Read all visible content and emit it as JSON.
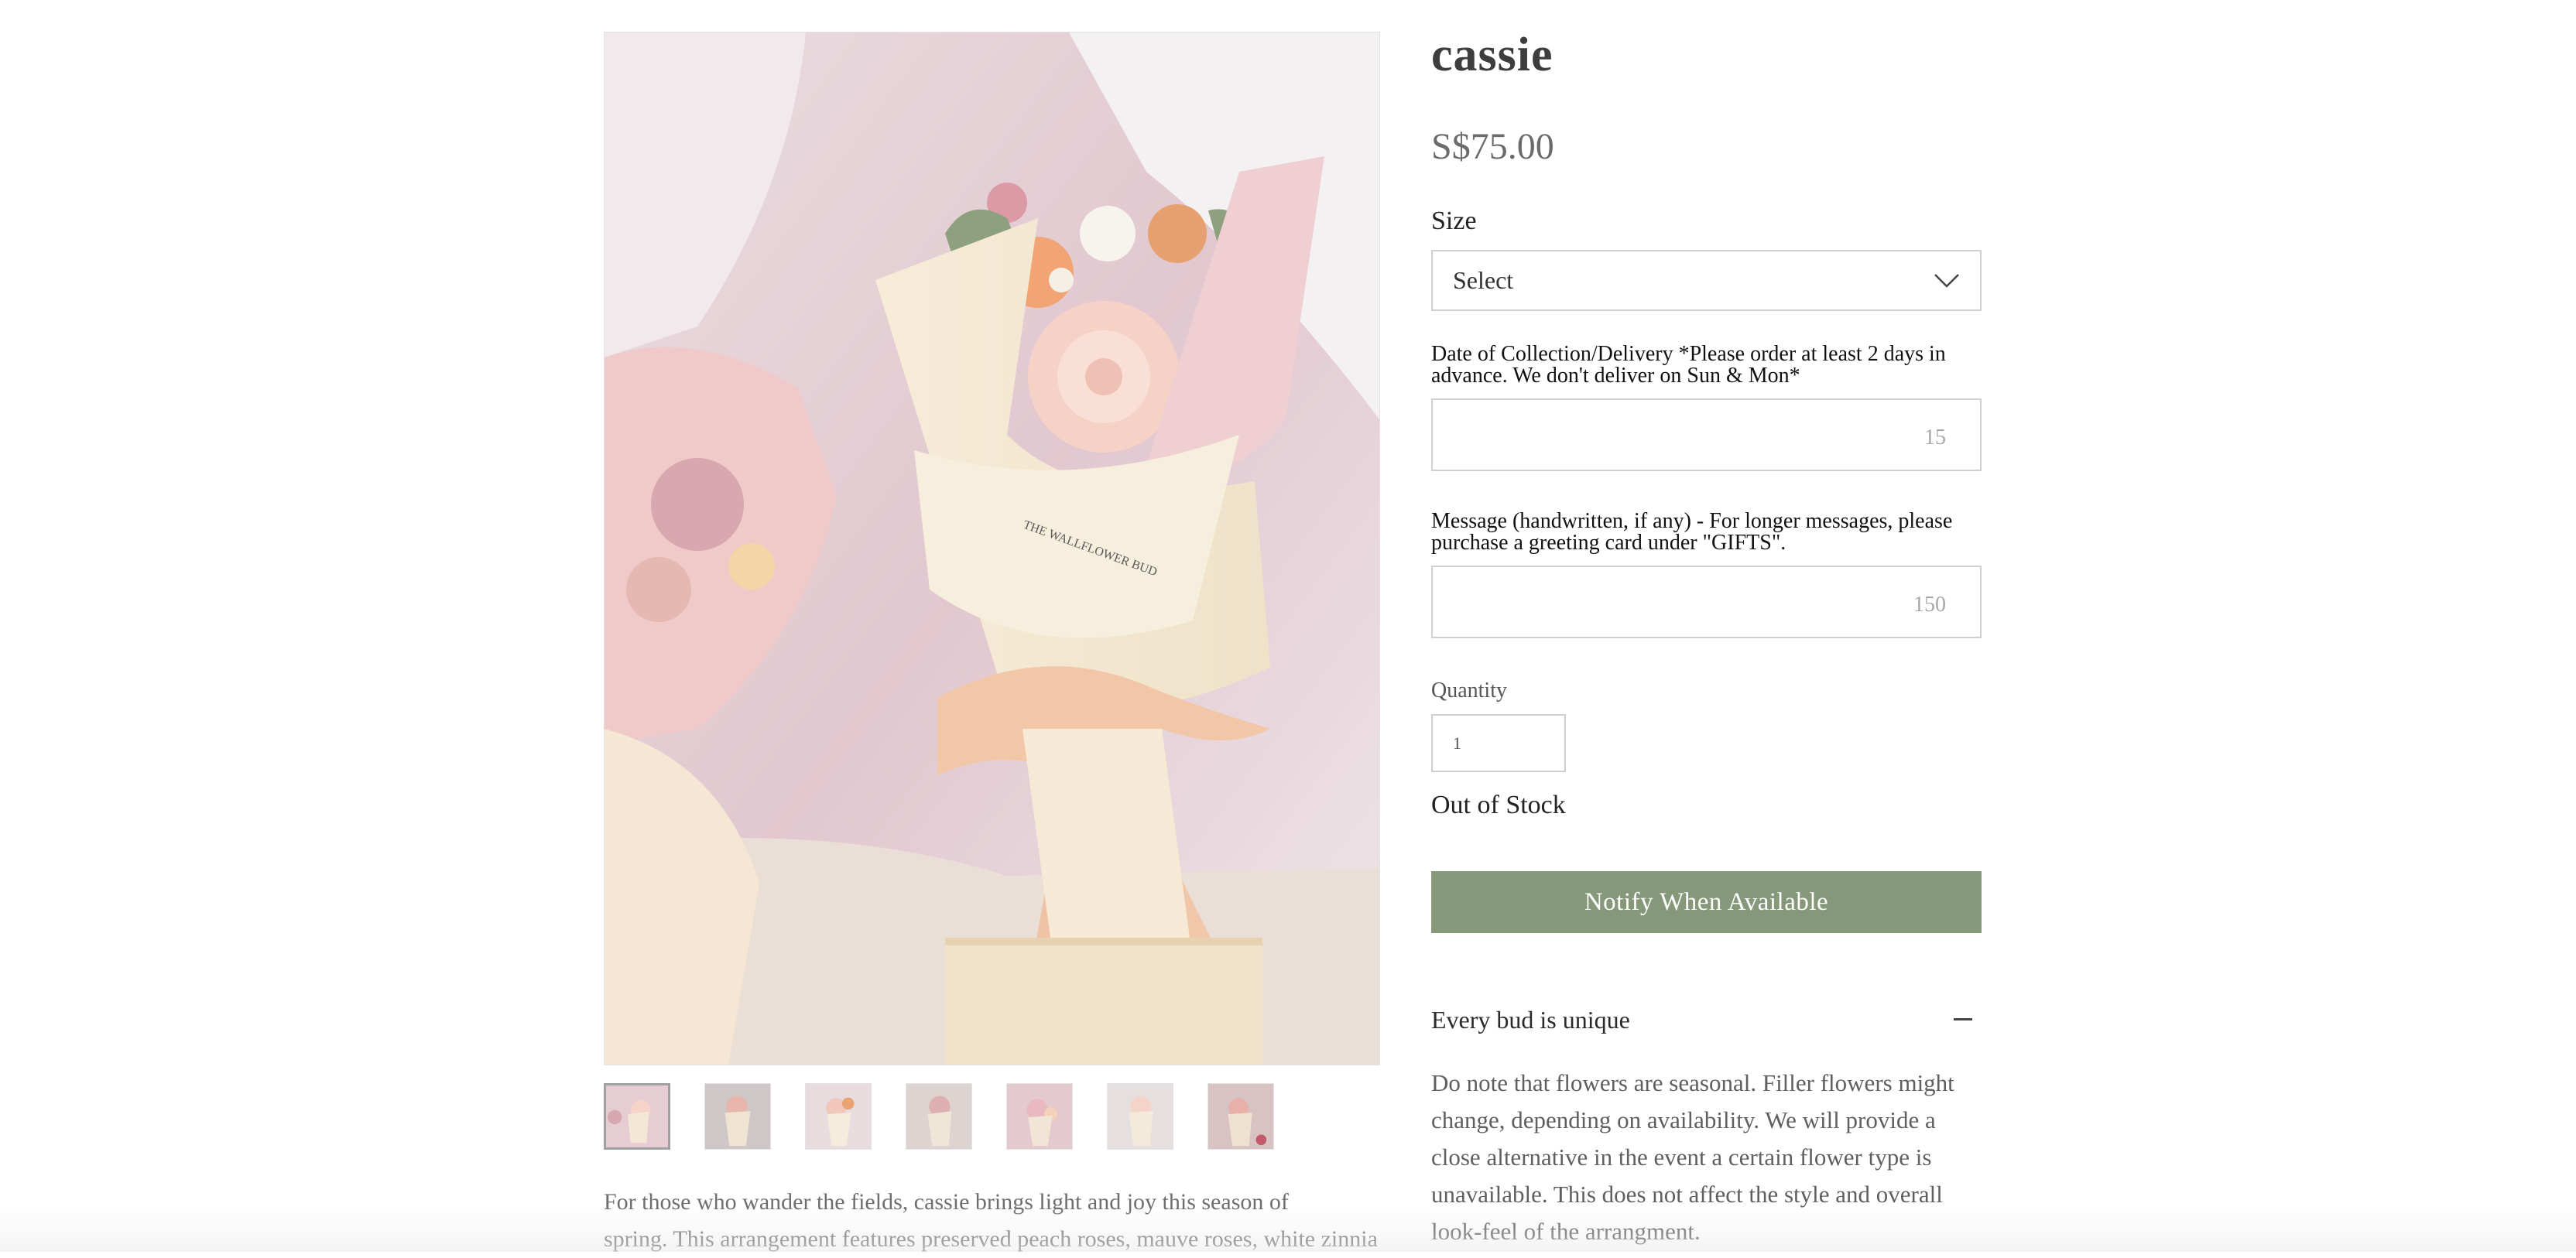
{
  "product": {
    "name": "cassie",
    "price": "S$75.00"
  },
  "gallery": {
    "main_image_alt": "Main product photo",
    "thumbnails": [
      {
        "label": "Product photo 1"
      },
      {
        "label": "Product photo 2"
      },
      {
        "label": "Product photo 3"
      },
      {
        "label": "Product photo 4"
      },
      {
        "label": "Product photo 5"
      },
      {
        "label": "Product photo 6"
      },
      {
        "label": "Product photo 7"
      }
    ]
  },
  "description": {
    "line1": "For those who wander the fields, cassie brings light and joy this season of",
    "line2": "spring. This arrangement features preserved peach roses, mauve roses, white zinnia"
  },
  "options": {
    "size_label": "Size",
    "size_value": "Select",
    "date_label": "Date of Collection/Delivery *Please order at least 2 days in advance. We don't deliver on Sun & Mon*",
    "date_char_count": "15",
    "message_label": "Message (handwritten, if any) - For longer messages, please purchase a greeting card under \"GIFTS\".",
    "message_char_count": "150",
    "quantity_label": "Quantity",
    "quantity_value": "1"
  },
  "stock": {
    "status": "Out of Stock",
    "notify_label": "Notify When Available"
  },
  "accordion": {
    "title": "Every bud is unique",
    "body_lines": [
      "Do note that flowers are seasonal. Filler flowers might",
      "change, depending on availability. We will provide a",
      "close alternative in the event a certain flower type is",
      "unavailable. This does not affect the style and overall",
      "look-feel of the arrangment."
    ]
  },
  "colors": {
    "button_green": "#86987a",
    "field_border": "#cfcfcf",
    "text_gray": "#6b6b6b"
  },
  "icons": {
    "size_dropdown": "chevron-down-icon",
    "accordion_toggle": "minus-icon"
  }
}
